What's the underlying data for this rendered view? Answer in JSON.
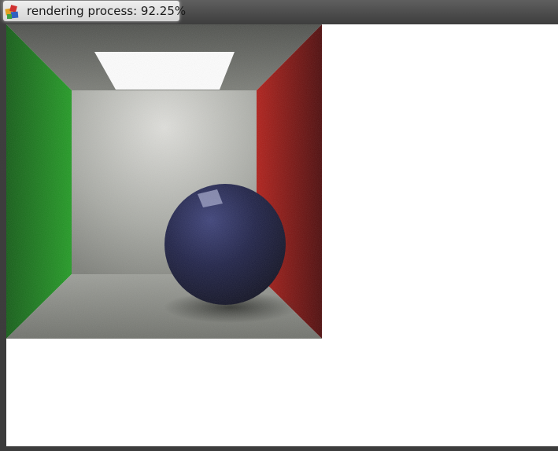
{
  "window": {
    "title": "rendering process: 92.25%",
    "progress_percent": 92.25,
    "app_icon": "app-icon"
  },
  "canvas": {
    "scene": "cornell-box",
    "colors": {
      "left_wall": "#1e8a1e",
      "right_wall": "#a01212",
      "back_wall": "#b4b4b0",
      "floor": "#9a9c96",
      "ceiling_light": "#ffffff",
      "sphere": "#1b1e45",
      "background": "#ffffff"
    }
  }
}
